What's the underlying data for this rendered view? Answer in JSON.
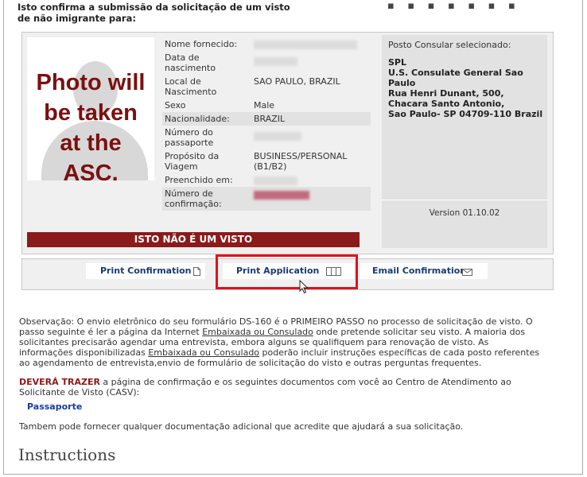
{
  "header": {
    "line1": "Isto confirma a submissão da solicitação de um visto",
    "line2": "de não imigrante para:",
    "partial_heading": "▪ ▪ ▪ ▪ ▪ ▪ ▪"
  },
  "photo": {
    "text_line1": "Photo will",
    "text_line2": "be taken",
    "text_line3": "at the",
    "text_line4": "ASC."
  },
  "applicant": {
    "rows": [
      {
        "label": "Nome fornecido:",
        "value": "",
        "blurred": true
      },
      {
        "label": "Data de nascimento",
        "value": "",
        "blurred": true
      },
      {
        "label": "Local de Nascimento",
        "value": "SAO PAULO, BRAZIL",
        "blurred": false
      },
      {
        "label": "Sexo",
        "value": "Male",
        "blurred": false
      },
      {
        "label": "Nacionalidade:",
        "value": "BRAZIL",
        "blurred": false
      },
      {
        "label": "Número do passaporte",
        "value": "",
        "blurred": true
      },
      {
        "label": "Propósito da Viagem",
        "value": "BUSINESS/PERSONAL (B1/B2)",
        "blurred": false
      },
      {
        "label": "Preenchido em:",
        "value": "",
        "blurred": true
      },
      {
        "label": "Número de confirmação:",
        "value": "",
        "blurred": true
      }
    ]
  },
  "banner": {
    "not_visa": "ISTO NÃO É UM VISTO"
  },
  "consular_post": {
    "title": "Posto Consular selecionado:",
    "line1": "SPL",
    "line2": "U.S. Consulate General Sao",
    "line3": "Paulo",
    "line4": "Rua Henri Dunant, 500,",
    "line5": "Chacara Santo Antonio,",
    "line6": "Sao Paulo- SP 04709-110 Brazil"
  },
  "version": "Version 01.10.02",
  "actions": {
    "print_confirmation": "Print Confirmation",
    "print_application": "Print Application",
    "email_confirmation": "Email Confirmation"
  },
  "note": {
    "part1": "Observação: O envio eletrônico do seu formulário DS-160 é o PRIMEIRO PASSO no processo de solicitação de visto. O passo seguinte é ler a página da Internet ",
    "link1": "Embaixada ou Consulado",
    "part2": " onde pretende solicitar seu visto. A maioria dos solicitantes precisarão agendar uma entrevista, embora alguns se qualifiquem para renovação de visto. As informações disponibilizadas ",
    "link2": "Embaixada ou Consulado",
    "part3": " poderão incluir instruções específicas de cada posto referentes ao agendamento de entrevista,envio de formulário de solicitação do visto e outras perguntas frequentes."
  },
  "bring": {
    "must": "DEVERÁ TRAZER",
    "rest": " a página de confirmação e os seguintes documentos com você ao Centro de Atendimento ao Solicitante de Visto (CASV):",
    "document": "Passaporte"
  },
  "additional": "Tambem pode fornecer qualquer documentação adicional que acredite que ajudará a sua solicitação.",
  "instructions_heading": "Instructions",
  "colors": {
    "banner": "#8b1a1a",
    "highlight": "#e0101a",
    "link_blue": "#1a3a6e"
  }
}
